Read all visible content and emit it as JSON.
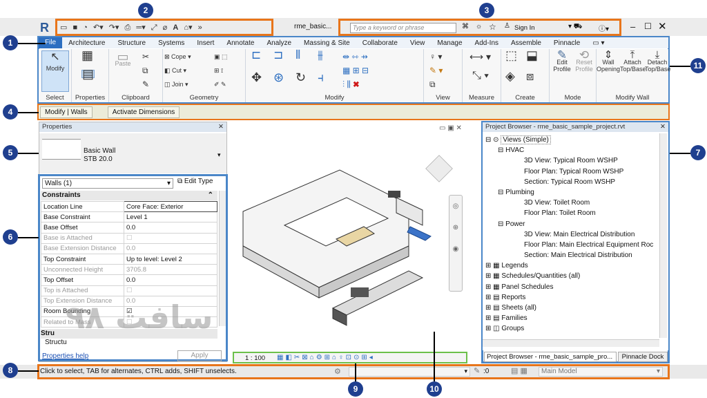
{
  "title": "rme_basic...",
  "search": {
    "placeholder": "Type a keyword or phrase"
  },
  "sign_in": "Sign In",
  "tabs": [
    "File",
    "Architecture",
    "Structure",
    "Systems",
    "Insert",
    "Annotate",
    "Analyze",
    "Massing & Site",
    "Collaborate",
    "View",
    "Manage",
    "Add-Ins",
    "Assemble",
    "Pinnacle"
  ],
  "ribbon": {
    "modify": "Modify",
    "select": "Select",
    "properties": "Properties",
    "clipboard": "Clipboard",
    "paste": "Paste",
    "cope": "Cope",
    "cut": "Cut",
    "join": "Join",
    "geometry": "Geometry",
    "modify_panel": "Modify",
    "view": "View",
    "measure": "Measure",
    "create": "Create",
    "edit_profile_1": "Edit",
    "edit_profile_2": "Profile",
    "reset_profile_1": "Reset",
    "reset_profile_2": "Profile",
    "mode": "Mode",
    "wall_opening_1": "Wall",
    "wall_opening_2": "Opening",
    "attach_1": "Attach",
    "attach_2": "Top/Base",
    "detach_1": "Detach",
    "detach_2": "Top/Base",
    "modify_wall": "Modify Wall"
  },
  "context": {
    "item1": "Modify | Walls",
    "item2": "Activate Dimensions"
  },
  "properties": {
    "title": "Properties",
    "type_name": "Basic Wall",
    "type_sub": "STB 20.0",
    "selector": "Walls (1)",
    "edit_type": "Edit Type",
    "group": "Constraints",
    "rows": [
      [
        "Location Line",
        "Core Face: Exterior"
      ],
      [
        "Base Constraint",
        "Level 1"
      ],
      [
        "Base Offset",
        "0.0"
      ],
      [
        "Base is Attached",
        ""
      ],
      [
        "Base Extension Distance",
        "0.0"
      ],
      [
        "Top Constraint",
        "Up to level: Level 2"
      ],
      [
        "Unconnected Height",
        "3705.8"
      ],
      [
        "Top Offset",
        "0.0"
      ],
      [
        "Top is Attached",
        ""
      ],
      [
        "Top Extension Distance",
        "0.0"
      ],
      [
        "Room Bounding",
        ""
      ],
      [
        "Related to Mass",
        ""
      ]
    ],
    "struct1": "Stru",
    "struct2": "Structu",
    "help": "Properties help",
    "apply": "Apply"
  },
  "browser": {
    "title": "Project Browser - rme_basic_sample_project.rvt",
    "tree": [
      "Views (Simple)",
      "HVAC",
      "3D View: Typical Room WSHP",
      "Floor Plan: Typical Room WSHP",
      "Section: Typical Room WSHP",
      "Plumbing",
      "3D View: Toilet Room",
      "Floor Plan: Toilet Room",
      "Power",
      "3D View: Main Electrical Distribution",
      "Floor Plan: Main Electrical Equipment Roc",
      "Section: Main Electrical Distribution",
      "Legends",
      "Schedules/Quantities (all)",
      "Panel Schedules",
      "Reports",
      "Sheets (all)",
      "Families",
      "Groups"
    ],
    "tab1": "Project Browser - rme_basic_sample_pro...",
    "tab2": "Pinnacle Dock"
  },
  "view_bar": {
    "scale": "1 : 100"
  },
  "status": {
    "text": "Click to select, TAB for alternates, CTRL adds, SHIFT unselects.",
    "zero": ":0",
    "model": "Main Model"
  },
  "markers": [
    "1",
    "2",
    "3",
    "4",
    "5",
    "6",
    "7",
    "8",
    "9",
    "10",
    "11"
  ],
  "watermark": "سافت ۹۸",
  "colors": {
    "callout_orange": "#e8751a",
    "callout_blue": "#4a86c8",
    "callout_green": "#6cc04a",
    "marker_navy": "#1f3f8f",
    "file_tab": "#2d6fc1"
  }
}
